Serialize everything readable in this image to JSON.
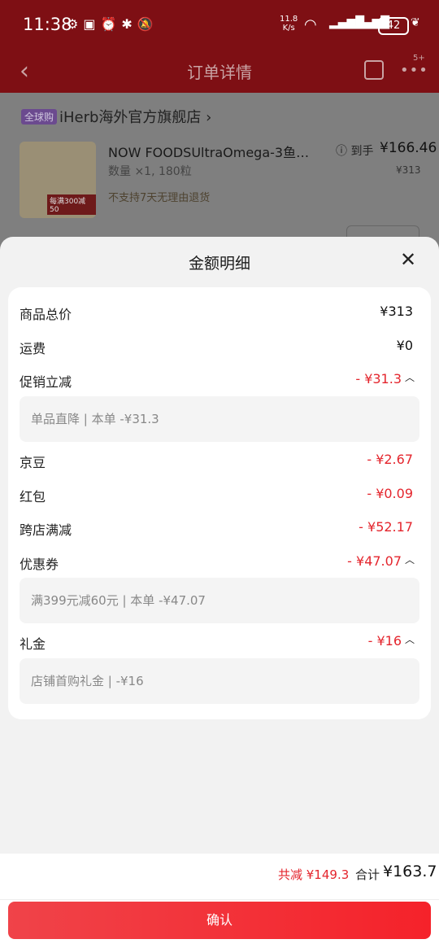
{
  "status_bar": {
    "time": "11:38",
    "net_speed_value": "11.8",
    "net_speed_unit": "K/s",
    "battery": "42"
  },
  "header": {
    "title": "订单详情",
    "more_badge": "5+"
  },
  "order": {
    "store_tag": "全球购",
    "store_name": "iHerb海外官方旗舰店 ›",
    "product_title": "NOW FOODSUltraOmega-3鱼油...",
    "quantity": "数量 ×1, 180粒",
    "return_policy": "不支持7天无理由退货",
    "price_label": "ⓘ 到手",
    "price": "¥166.46",
    "original_price": "¥313",
    "image_badge": "每满300减50"
  },
  "sheet": {
    "title": "金额明细",
    "rows": [
      {
        "label": "商品总价",
        "value": "¥313"
      },
      {
        "label": "运费",
        "value": "¥0"
      },
      {
        "label": "促销立减",
        "value": "- ¥31.3",
        "sub": "单品直降 | 本单 -¥31.3"
      },
      {
        "label": "京豆",
        "value": "- ¥2.67"
      },
      {
        "label": "红包",
        "value": "- ¥0.09"
      },
      {
        "label": "跨店满减",
        "value": "- ¥52.17"
      },
      {
        "label": "优惠券",
        "value": "- ¥47.07",
        "sub": "满399元减60元 | 本单 -¥47.07"
      },
      {
        "label": "礼金",
        "value": "- ¥16",
        "sub": "店铺首购礼金 | -¥16"
      }
    ]
  },
  "footer": {
    "reduce": "共减 ¥149.3",
    "total_label": "合计",
    "total": "¥163.7",
    "confirm_label": "确认"
  },
  "colors": {
    "accent_red": "#e4252d",
    "header_red": "#7e0f14"
  }
}
